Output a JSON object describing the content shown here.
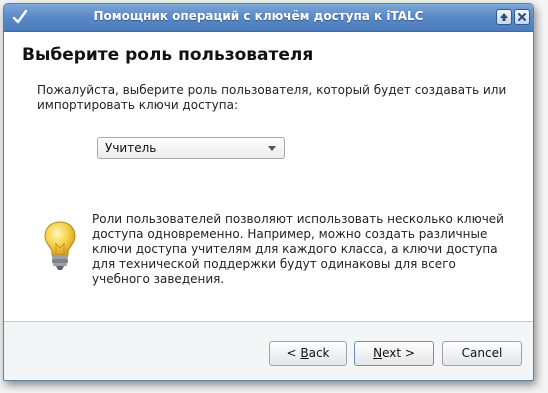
{
  "window": {
    "title": "Помощник операций с ключём доступа к iTALC"
  },
  "page": {
    "heading": "Выберите роль пользователя",
    "intro_line1": "Пожалуйста, выберите роль пользователя, который будет создавать или",
    "intro_line2": "импортировать ключи доступа:"
  },
  "role_select": {
    "value": "Учитель"
  },
  "info": {
    "line1": "Роли пользователей позволяют использовать несколько ключей",
    "line2": "доступа одновременно. Например, можно создать различные",
    "line3": "ключи доступа учителям для каждого класса, а ключи доступа",
    "line4": "для технической поддержки будут одинаковы для всего",
    "line5": "учебного заведения."
  },
  "buttons": {
    "back_prefix": "< ",
    "back_mnemonic": "B",
    "back_rest": "ack",
    "next_mnemonic": "N",
    "next_rest": "ext >",
    "cancel": "Cancel"
  },
  "icons": {
    "app": "checkmark-icon",
    "help": "help-arrow-icon",
    "close": "close-icon",
    "info": "lightbulb-icon"
  },
  "colors": {
    "titlebar": "#5b8bc8",
    "content_bg": "#ffffff",
    "bulb": "#f2c53a"
  }
}
